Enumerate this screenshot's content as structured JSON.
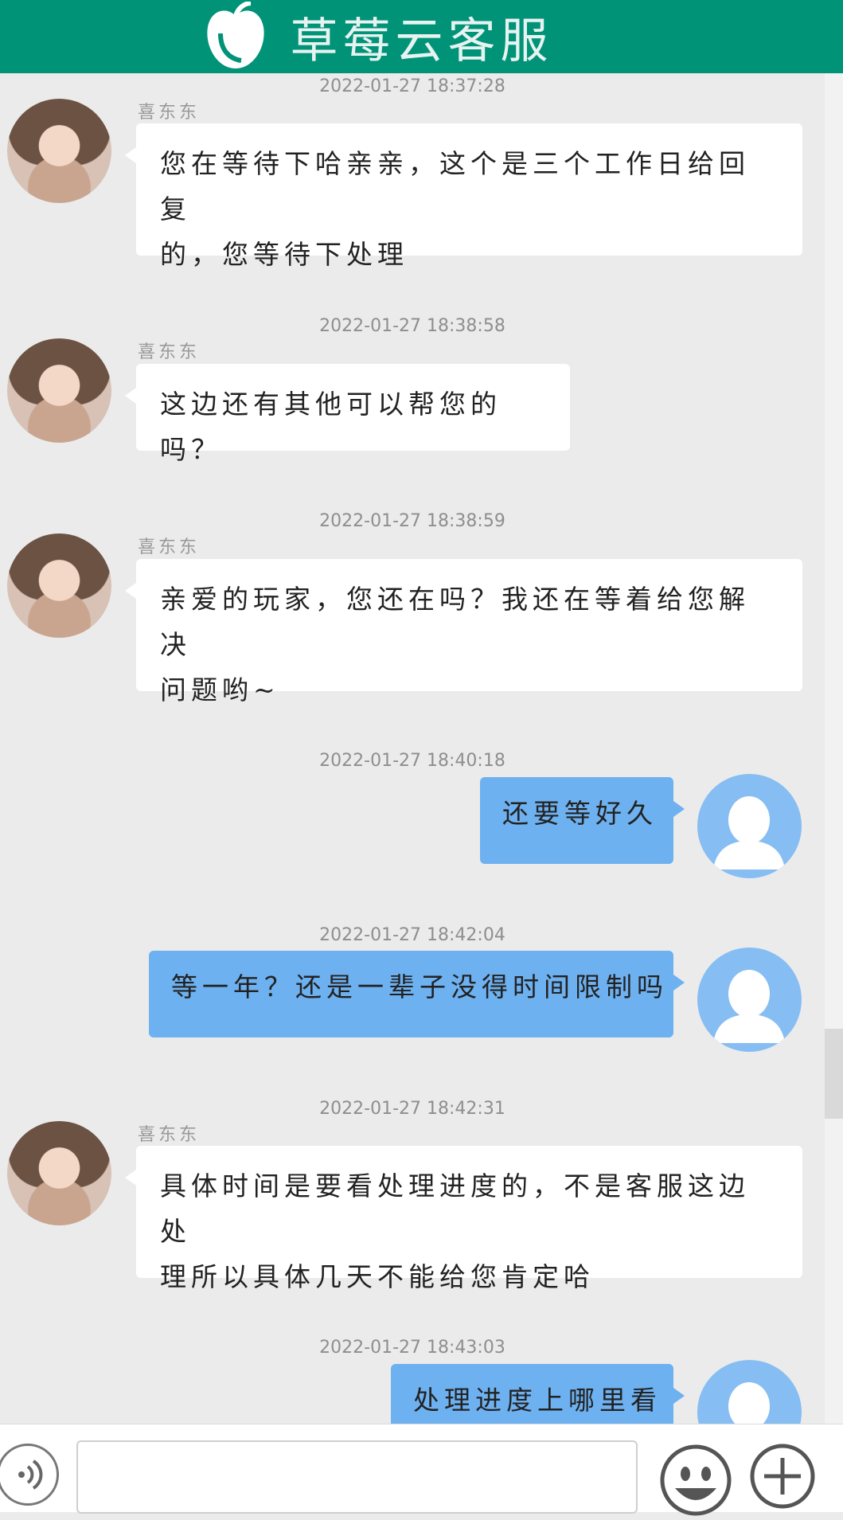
{
  "header": {
    "title": "草莓云客服",
    "logo_icon": "apple-logo-icon"
  },
  "messages": [
    {
      "side": "left",
      "time": "2022-01-27  18:37:28",
      "sender": "喜东东",
      "lines": [
        "您在等待下哈亲亲，这个是三个工作日给回复",
        "的，您等待下处理"
      ]
    },
    {
      "side": "left",
      "time": "2022-01-27  18:38:58",
      "sender": "喜东东",
      "lines": [
        "这边还有其他可以帮您的吗？"
      ]
    },
    {
      "side": "left",
      "time": "2022-01-27  18:38:59",
      "sender": "喜东东",
      "lines": [
        "亲爱的玩家，您还在吗？我还在等着给您解决",
        "问题哟~"
      ]
    },
    {
      "side": "right",
      "time": "2022-01-27  18:40:18",
      "text": "还要等好久"
    },
    {
      "side": "right",
      "time": "2022-01-27  18:42:04",
      "text": "等一年？还是一辈子没得时间限制吗"
    },
    {
      "side": "left",
      "time": "2022-01-27  18:42:31",
      "sender": "喜东东",
      "lines": [
        "具体时间是要看处理进度的，不是客服这边处",
        "理所以具体几天不能给您肯定哈"
      ]
    },
    {
      "side": "right",
      "time": "2022-01-27  18:43:03",
      "text": "处理进度上哪里看"
    }
  ],
  "footer": {
    "input_value": "",
    "voice_icon": "voice-icon",
    "emoji_icon": "emoji-icon",
    "plus_icon": "plus-icon"
  },
  "colors": {
    "header": "#009378",
    "bubble_user": "#6eb1f0",
    "background": "#ebebeb"
  }
}
